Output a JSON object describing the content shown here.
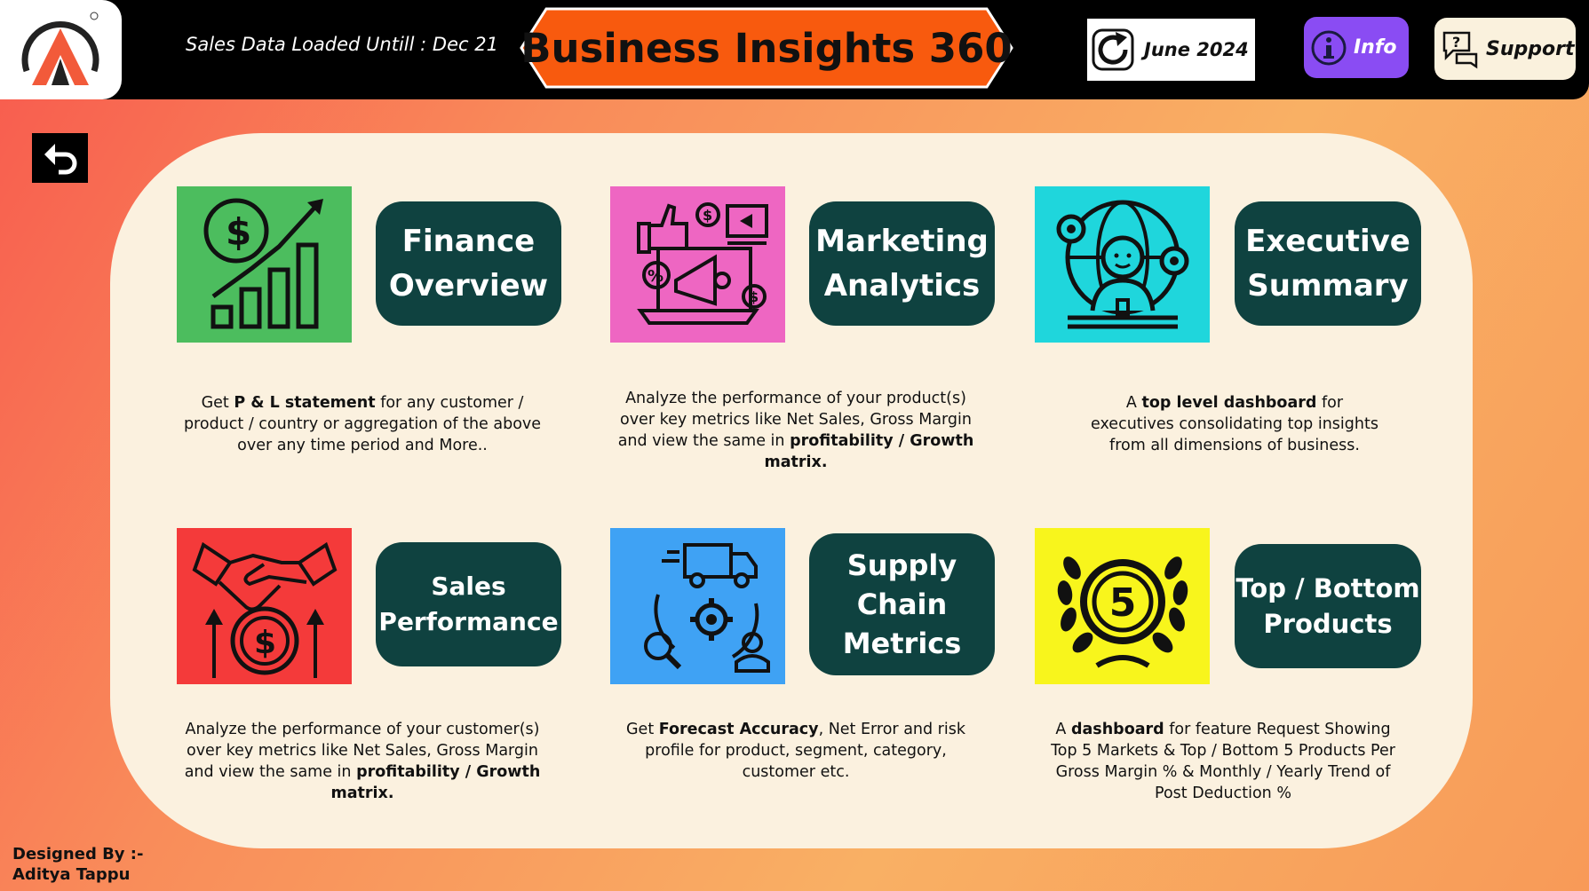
{
  "header": {
    "loaded_text": "Sales Data Loaded Untill : Dec 21",
    "title": "Business Insights 360",
    "refresh": {
      "label": "June 2024",
      "icon": "refresh-icon"
    },
    "info": {
      "label": "Info",
      "icon": "info-icon"
    },
    "support": {
      "label": "Support",
      "icon": "support-chat-icon"
    }
  },
  "back": {
    "icon": "back-arrow-icon"
  },
  "cards": [
    {
      "title_line1": "Finance",
      "title_line2": "Overview",
      "icon": "finance-growth-icon",
      "tile_color": "#4cbd5e",
      "desc": {
        "pre": "Get  ",
        "b1": "P & L statement",
        "mid": " for any customer / product / country or aggregation of the above over any time period and More..",
        "b2": "",
        "post": ""
      }
    },
    {
      "title_line1": "Marketing",
      "title_line2": "Analytics",
      "icon": "marketing-megaphone-icon",
      "tile_color": "#ee66c2",
      "desc": {
        "pre": "Analyze the performance of your product(s) over key metrics like Net Sales, Gross Margin and view the same in ",
        "b1": "profitability / Growth matrix.",
        "mid": "",
        "b2": "",
        "post": ""
      }
    },
    {
      "title_line1": "Executive",
      "title_line2": "Summary",
      "icon": "executive-globe-icon",
      "tile_color": "#1fd6dc",
      "desc": {
        "pre": "A ",
        "b1": "top level dashboard",
        "mid": " for executives consolidating top insights from all dimensions of business.",
        "b2": "",
        "post": ""
      }
    },
    {
      "title_line1": "Sales",
      "title_line2": "Performance",
      "icon": "handshake-dollar-icon",
      "tile_color": "#f43a3a",
      "desc": {
        "pre": "Analyze the performance of your customer(s) over key metrics like Net Sales, Gross Margin and view the same in ",
        "b1": "profitability / Growth matrix.",
        "mid": "",
        "b2": "",
        "post": ""
      }
    },
    {
      "title_line1": "Supply",
      "title_line2": "Chain",
      "title_line3": "Metrics",
      "icon": "supply-chain-truck-icon",
      "tile_color": "#3fa2f4",
      "desc": {
        "pre": "Get ",
        "b1": "Forecast Accuracy",
        "mid": ", Net Error and risk profile for product, segment, category, customer etc.",
        "b2": "",
        "post": ""
      }
    },
    {
      "title_line1": "Top / Bottom",
      "title_line2": "Products",
      "icon": "top-five-badge-icon",
      "tile_color": "#f8f51c",
      "badge_number": "5",
      "desc": {
        "pre": "A ",
        "b1": "dashboard",
        "mid": " for feature Request Showing Top 5 Markets & Top / Bottom 5 Products Per Gross Margin % & Monthly / Yearly Trend of Post Deduction %",
        "b2": "",
        "post": ""
      }
    }
  ],
  "footer": {
    "designed_label": "Designed By :-",
    "designer": "Aditya Tappu"
  },
  "colors": {
    "pill_bg": "#0f4240",
    "panel_bg": "#fbf1df",
    "title_banner": "#f85a0e",
    "info_bg": "#8a4cf3"
  }
}
